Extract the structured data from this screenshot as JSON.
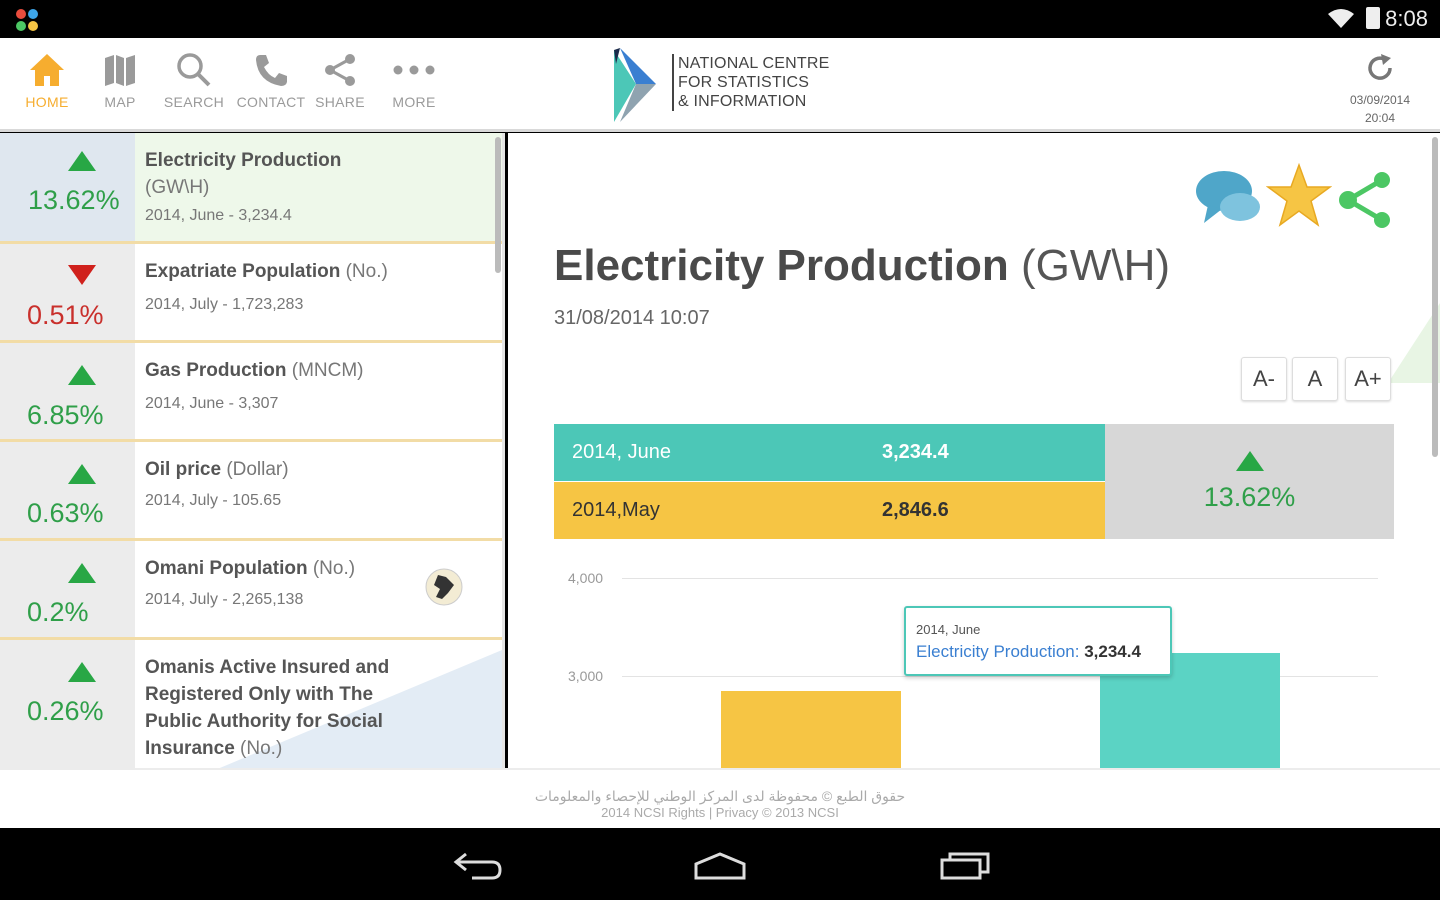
{
  "status_bar": {
    "time": "8:08"
  },
  "nav": [
    {
      "label": "HOME",
      "icon": "home-icon",
      "active": true
    },
    {
      "label": "MAP",
      "icon": "map-icon"
    },
    {
      "label": "SEARCH",
      "icon": "search-icon"
    },
    {
      "label": "CONTACT",
      "icon": "phone-icon"
    },
    {
      "label": "SHARE",
      "icon": "share-icon"
    },
    {
      "label": "MORE",
      "icon": "more-icon"
    }
  ],
  "logo": {
    "line1": "NATIONAL CENTRE",
    "line2": "FOR STATISTICS",
    "line3": "& INFORMATION"
  },
  "refresh": {
    "date": "03/09/2014",
    "time": "20:04"
  },
  "indicators": [
    {
      "name": "Electricity Production",
      "unit": "(GW\\H)",
      "detail": "2014, June - 3,234.4",
      "change": "13.62%",
      "direction": "up",
      "selected": true
    },
    {
      "name": "Expatriate Population",
      "unit": "(No.)",
      "detail": "2014, July - 1,723,283",
      "change": "0.51%",
      "direction": "down"
    },
    {
      "name": "Gas Production",
      "unit": "(MNCM)",
      "detail": "2014, June - 3,307",
      "change": "6.85%",
      "direction": "up"
    },
    {
      "name": "Oil price",
      "unit": "(Dollar)",
      "detail": "2014, July - 105.65",
      "change": "0.63%",
      "direction": "up"
    },
    {
      "name": "Omani Population",
      "unit": "(No.)",
      "detail": "2014, July - 2,265,138",
      "change": "0.2%",
      "direction": "up"
    },
    {
      "name": "Omanis Active Insured and Registered Only with The Public Authority for Social Insurance",
      "unit": "(No.)",
      "detail": "",
      "change": "0.26%",
      "direction": "up"
    }
  ],
  "detail": {
    "title": "Electricity Production",
    "unit": "(GW\\H)",
    "date": "31/08/2014 10:07",
    "font_buttons": [
      "A-",
      "A",
      "A+"
    ],
    "current_period": "2014, June",
    "current_value": "3,234.4",
    "previous_period": "2014,May",
    "previous_value": "2,846.6",
    "change": "13.62%",
    "tooltip_period": "2014, June",
    "tooltip_series": "Electricity Production:",
    "tooltip_value": "3,234.4"
  },
  "chart_data": {
    "type": "bar",
    "categories": [
      "2014,May",
      "2014, June"
    ],
    "values": [
      2846.6,
      3234.4
    ],
    "colors": [
      "#f6c544",
      "#5bd3c4"
    ],
    "y_ticks": [
      "4,000",
      "3,000"
    ],
    "ylim_visible": [
      2300,
      4000
    ]
  },
  "footer": {
    "arabic": "حقوق الطبع © محفوظة لدى المركز الوطني للإحصاء والمعلومات",
    "english": "2014 NCSI Rights | Privacy © 2013 NCSI"
  },
  "colors": {
    "accent_teal": "#4cc7b7",
    "accent_yellow": "#f6c544",
    "up_green": "#2f9f49",
    "down_red": "#c9302c",
    "home_orange": "#f6ad2f"
  }
}
